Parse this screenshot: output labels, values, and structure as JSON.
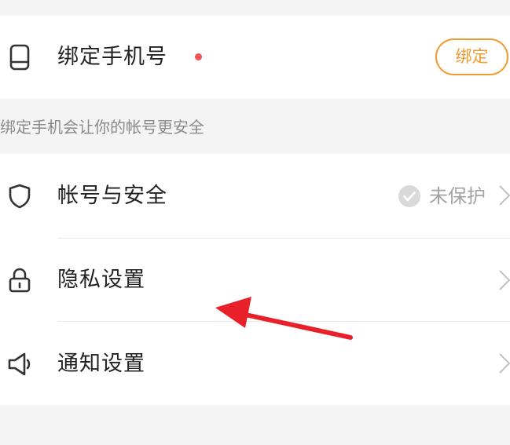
{
  "bind_phone": {
    "label": "绑定手机号",
    "button_label": "绑定",
    "icon": "phone-icon",
    "has_red_dot": true
  },
  "hint": {
    "text": "绑定手机会让你的帐号更安全"
  },
  "settings": {
    "items": [
      {
        "label": "帐号与安全",
        "icon": "shield-icon",
        "status": "未保护",
        "status_icon": "check-circle-icon"
      },
      {
        "label": "隐私设置",
        "icon": "lock-icon"
      },
      {
        "label": "通知设置",
        "icon": "megaphone-icon"
      }
    ]
  },
  "colors": {
    "accent": "#f29b2c",
    "red_dot": "#f25454",
    "annotation_arrow": "#e8202a",
    "background": "#f4f4f4"
  }
}
